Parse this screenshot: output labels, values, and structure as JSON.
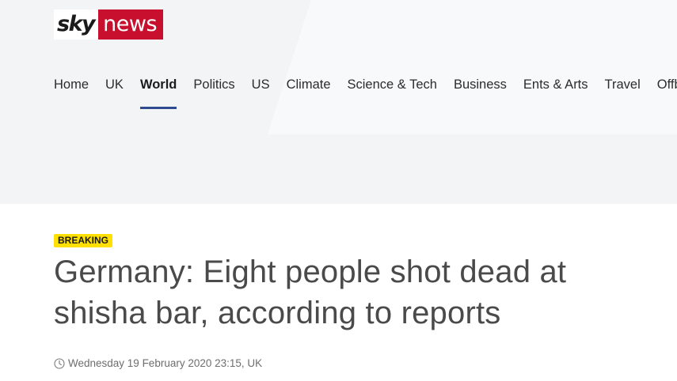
{
  "brand": {
    "sky": "sky",
    "news": "news",
    "news_color": "#c8102e"
  },
  "nav": {
    "active_index": 2,
    "items": [
      {
        "label": "Home"
      },
      {
        "label": "UK"
      },
      {
        "label": "World"
      },
      {
        "label": "Politics"
      },
      {
        "label": "US"
      },
      {
        "label": "Climate"
      },
      {
        "label": "Science & Tech"
      },
      {
        "label": "Business"
      },
      {
        "label": "Ents & Arts"
      },
      {
        "label": "Travel"
      },
      {
        "label": "Offbeat"
      }
    ],
    "active_underline_color": "#2d4b8e"
  },
  "article": {
    "badge": "BREAKING",
    "badge_color": "#ffe000",
    "headline": "Germany: Eight people shot dead at shisha bar, according to reports",
    "timestamp": "Wednesday 19 February 2020 23:15, UK",
    "timestamp_icon": "clock-icon"
  }
}
